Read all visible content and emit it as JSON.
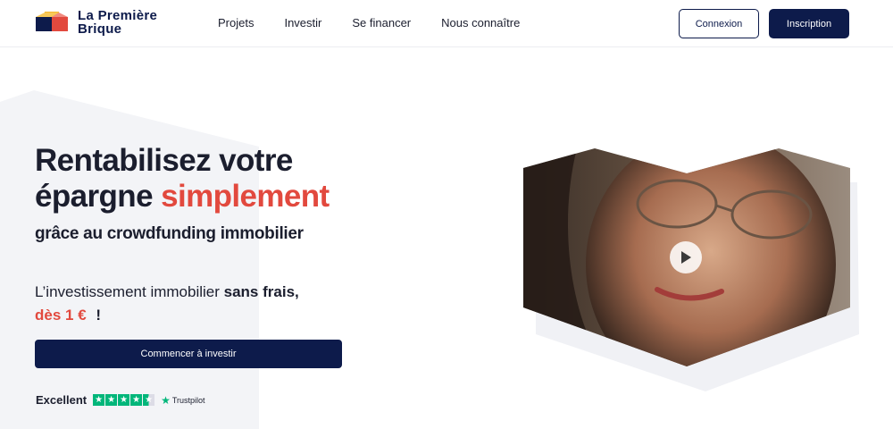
{
  "brand": {
    "name_line1": "La Première",
    "name_line2": "Brique",
    "colors": {
      "navy": "#0d1b4b",
      "red": "#e2493e",
      "yellow": "#f5b731",
      "trustpilot_green": "#00b67a"
    }
  },
  "nav": {
    "items": [
      {
        "label": "Projets"
      },
      {
        "label": "Investir"
      },
      {
        "label": "Se financer"
      },
      {
        "label": "Nous connaître"
      }
    ],
    "login_label": "Connexion",
    "signup_label": "Inscription"
  },
  "hero": {
    "title_line1": "Rentabilisez votre",
    "title_line2_plain": "épargne",
    "title_line2_accent": "simplement",
    "subtitle": "grâce au crowdfunding immobilier",
    "tagline_plain": "L’investissement immobilier",
    "tagline_bold": "sans frais,",
    "tagline_accent": "dès 1 €",
    "tagline_end": "!",
    "cta_label": "Commencer à investir"
  },
  "trustpilot": {
    "label": "Excellent",
    "rating_stars": 4.5,
    "brand": "Trustpilot"
  },
  "video": {
    "icons": [
      "play-icon"
    ]
  }
}
